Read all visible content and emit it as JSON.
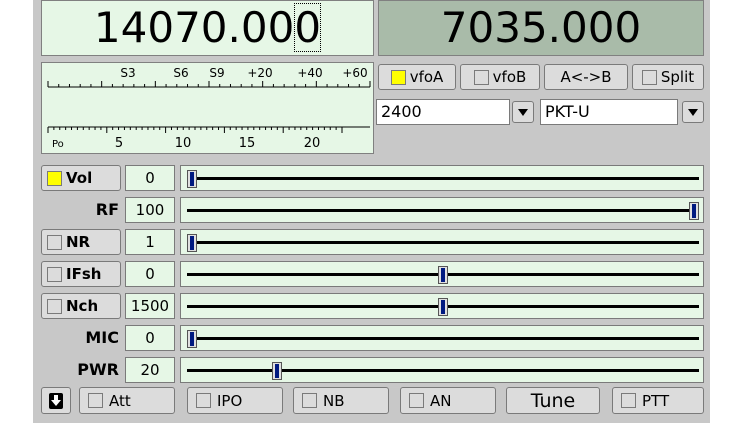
{
  "vfo_a_freq_left": "14070.00",
  "vfo_a_freq_last": "0",
  "vfo_b_freq": "7035.000",
  "meter": {
    "s_labels": [
      "S3",
      "S6",
      "S9",
      "+20",
      "+40",
      "+60"
    ],
    "p_labels": [
      "Po",
      "5",
      "10",
      "15",
      "20"
    ]
  },
  "buttons": {
    "vfoA": "vfoA",
    "vfoB": "vfoB",
    "swap": "A<->B",
    "split": "Split"
  },
  "bandwidth": "2400",
  "mode": "PKT-U",
  "controls": [
    {
      "label": "Vol",
      "value": "0",
      "checkbox": true,
      "checked": true,
      "level": 0
    },
    {
      "label": "RF",
      "value": "100",
      "checkbox": false,
      "level": 1
    },
    {
      "label": "NR",
      "value": "1",
      "checkbox": true,
      "checked": false,
      "level": 0
    },
    {
      "label": "IFsh",
      "value": "0",
      "checkbox": true,
      "checked": false,
      "level": 0.5
    },
    {
      "label": "Nch",
      "value": "1500",
      "checkbox": true,
      "checked": false,
      "level": 0.5
    },
    {
      "label": "MIC",
      "value": "0",
      "checkbox": false,
      "level": 0
    },
    {
      "label": "PWR",
      "value": "20",
      "checkbox": false,
      "level": 0.17
    }
  ],
  "bottom": {
    "att": "Att",
    "ipo": "IPO",
    "nb": "NB",
    "an": "AN",
    "tune": "Tune",
    "ptt": "PTT"
  }
}
